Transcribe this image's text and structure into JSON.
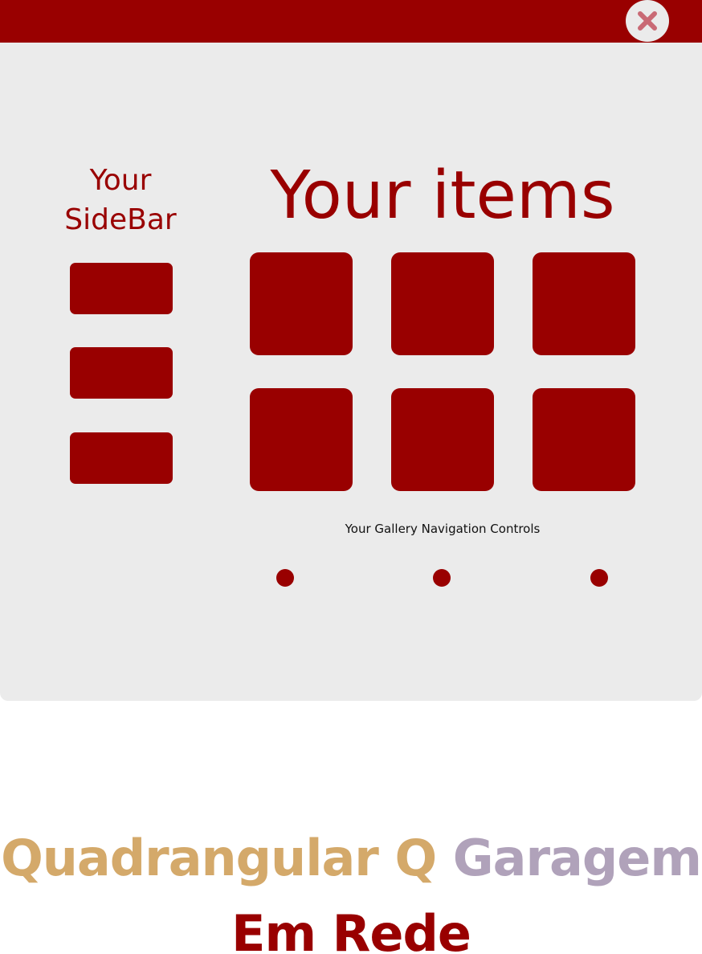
{
  "colors": {
    "brand": "#990000",
    "panel_background": "#ebebeb",
    "wordmark_gold": "#d4a96a",
    "wordmark_lavender": "#b0a2ba",
    "close_icon": "#c96a75"
  },
  "window": {
    "close_icon": "close-icon"
  },
  "sidebar": {
    "title_line1": "Your",
    "title_line2": "SideBar",
    "button_count": 3
  },
  "main": {
    "title": "Your items",
    "item_count": 6,
    "nav_caption": "Your Gallery Navigation Controls",
    "nav_dot_count": 3
  },
  "wordmark": {
    "part1": "Quadrangular Q",
    "part2": "Garagem",
    "line2": "Em Rede"
  }
}
